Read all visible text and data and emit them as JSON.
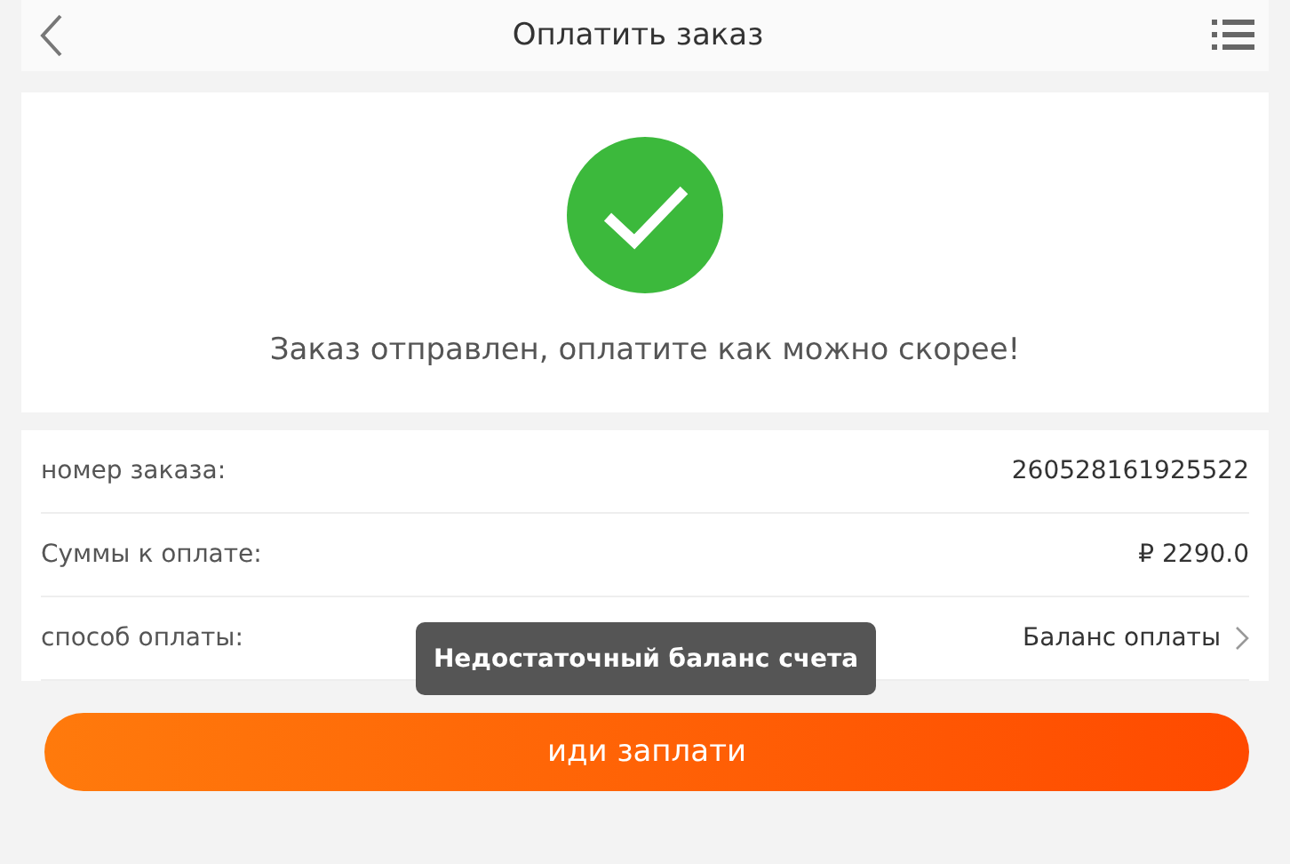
{
  "header": {
    "title": "Оплатить заказ"
  },
  "status": {
    "kind": "success",
    "message": "Заказ отправлен, оплатите как можно скорее!"
  },
  "details": [
    {
      "kind": "text",
      "label": "номер заказа:",
      "value": "260528161925522"
    },
    {
      "kind": "text",
      "label": "Суммы к оплате:",
      "value": "₽ 2290.0"
    },
    {
      "kind": "link",
      "label": "способ оплаты:",
      "value": "Баланс оплаты"
    }
  ],
  "pay_button": "иди заплати",
  "toast": "Недостаточный баланс счета"
}
